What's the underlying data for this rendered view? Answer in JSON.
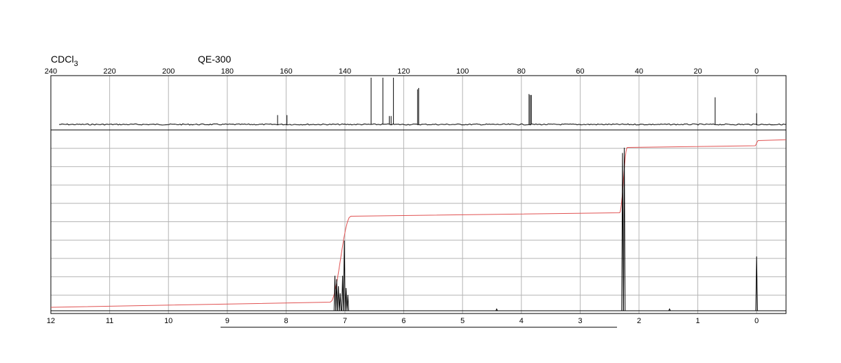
{
  "header": {
    "solvent_main": "CDCl",
    "solvent_sub": "3",
    "instrument": "QE-300"
  },
  "chart_data": [
    {
      "type": "line",
      "panel": "13C NMR",
      "x_ticks": [
        "240",
        "220",
        "200",
        "180",
        "160",
        "140",
        "120",
        "100",
        "80",
        "60",
        "40",
        "20",
        "0"
      ],
      "x_tick_values": [
        240,
        220,
        200,
        180,
        160,
        140,
        120,
        100,
        80,
        60,
        40,
        20,
        0
      ],
      "xlim": [
        240,
        -10
      ],
      "x_reversed": true,
      "grid": true,
      "peaks": [
        {
          "ppm": 162.9,
          "height": 0.2
        },
        {
          "ppm": 159.7,
          "height": 0.2
        },
        {
          "ppm": 131.1,
          "height": 1.0
        },
        {
          "ppm": 127.1,
          "height": 1.0
        },
        {
          "ppm": 124.9,
          "height": 0.18
        },
        {
          "ppm": 124.3,
          "height": 0.18
        },
        {
          "ppm": 123.5,
          "height": 1.0
        },
        {
          "ppm": 115.3,
          "height": 0.75
        },
        {
          "ppm": 114.9,
          "height": 0.78
        },
        {
          "ppm": 77.4,
          "height": 0.65
        },
        {
          "ppm": 77.0,
          "height": 0.63
        },
        {
          "ppm": 76.6,
          "height": 0.63
        },
        {
          "ppm": 14.1,
          "height": 0.58
        },
        {
          "ppm": 0.0,
          "height": 0.24
        }
      ]
    },
    {
      "type": "line",
      "panel": "1H NMR",
      "x_ticks": [
        "12",
        "11",
        "10",
        "9",
        "8",
        "7",
        "6",
        "5",
        "4",
        "3",
        "2",
        "1",
        "0"
      ],
      "x_tick_values": [
        12,
        11,
        10,
        9,
        8,
        7,
        6,
        5,
        4,
        3,
        2,
        1,
        0
      ],
      "xlim": [
        12,
        -0.5
      ],
      "x_reversed": true,
      "grid": true,
      "peaks": [
        {
          "ppm": 7.17,
          "height": 0.2
        },
        {
          "ppm": 7.14,
          "height": 0.18
        },
        {
          "ppm": 7.11,
          "height": 0.14
        },
        {
          "ppm": 7.08,
          "height": 0.1
        },
        {
          "ppm": 7.04,
          "height": 0.2
        },
        {
          "ppm": 7.01,
          "height": 0.4
        },
        {
          "ppm": 6.98,
          "height": 0.13
        },
        {
          "ppm": 6.95,
          "height": 0.09
        },
        {
          "ppm": 4.42,
          "height": 0.01
        },
        {
          "ppm": 2.28,
          "height": 0.9
        },
        {
          "ppm": 2.25,
          "height": 0.93
        },
        {
          "ppm": 1.48,
          "height": 0.01
        },
        {
          "ppm": 0.0,
          "height": 0.31
        }
      ],
      "integral_steps": [
        {
          "from_ppm": 7.25,
          "to_ppm": 6.9,
          "start": 0.03,
          "end": 0.53
        },
        {
          "from_ppm": 2.33,
          "to_ppm": 2.2,
          "start": 0.55,
          "end": 0.93
        },
        {
          "from_ppm": 0.03,
          "to_ppm": -0.03,
          "start": 0.94,
          "end": 0.97
        }
      ]
    }
  ],
  "colors": {
    "spectrum": "#000000",
    "grid": "#b4b4b4",
    "integral": "#e05050",
    "frame": "#000000"
  }
}
